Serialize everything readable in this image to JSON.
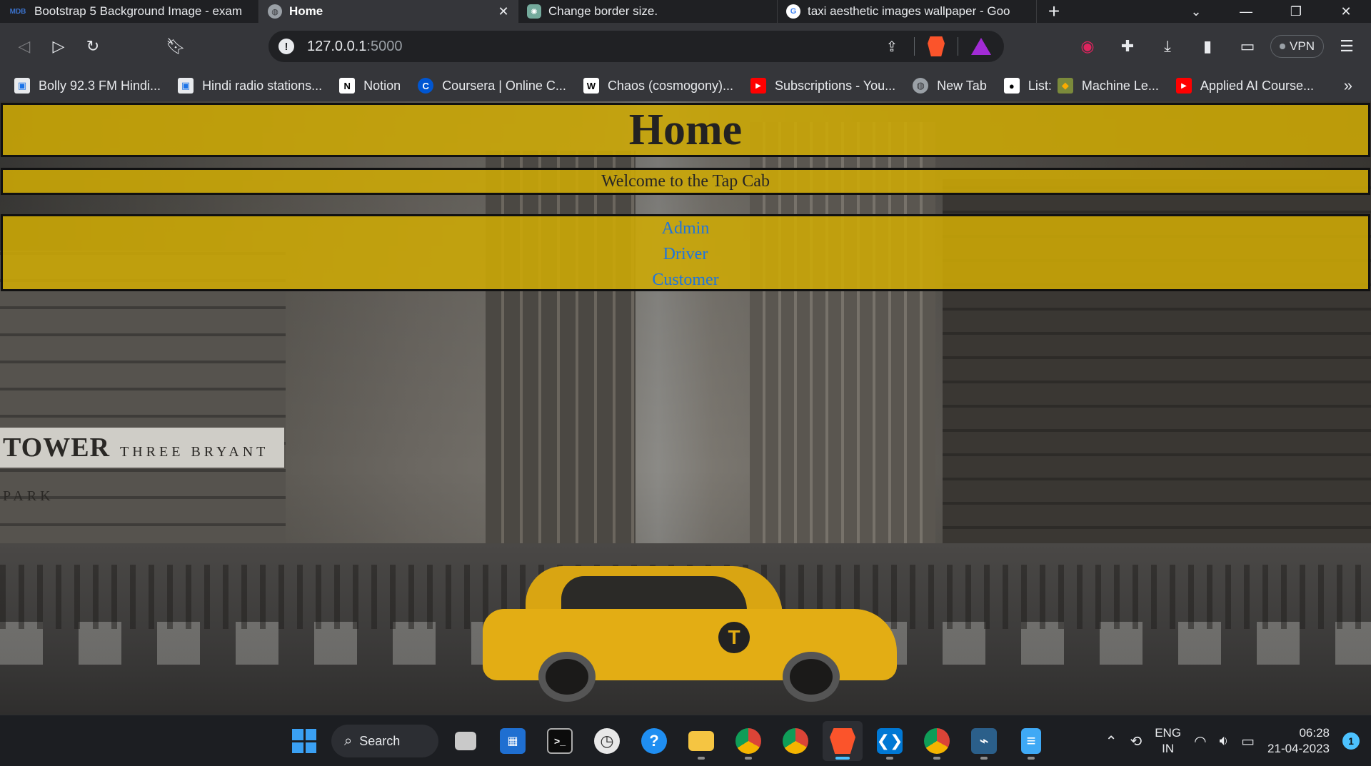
{
  "browser": {
    "tabs": [
      {
        "title": "Bootstrap 5 Background Image - exam",
        "icon": "mdb-icon",
        "active": false
      },
      {
        "title": "Home",
        "icon": "globe-icon",
        "active": true
      },
      {
        "title": "Change border size.",
        "icon": "chatgpt-icon",
        "active": false
      },
      {
        "title": "taxi aesthetic images wallpaper - Goo",
        "icon": "google-icon",
        "active": false
      }
    ],
    "new_tab_label": "+",
    "address": {
      "host": "127.0.0.1",
      "port": ":5000"
    },
    "vpn_label": "VPN",
    "bookmarks": [
      {
        "label": "Bolly 92.3 FM Hindi...",
        "icon": "radio-icon"
      },
      {
        "label": "Hindi radio stations...",
        "icon": "radio-icon"
      },
      {
        "label": "Notion",
        "icon": "notion-icon"
      },
      {
        "label": "Coursera | Online C...",
        "icon": "coursera-icon"
      },
      {
        "label": "Chaos (cosmogony)...",
        "icon": "wikipedia-icon"
      },
      {
        "label": "Subscriptions - You...",
        "icon": "youtube-icon"
      },
      {
        "label": "New Tab",
        "icon": "globe-icon"
      },
      {
        "label": "List: ",
        "icon": "medium-icon"
      },
      {
        "label": "Machine Le...",
        "icon": "colab-icon"
      },
      {
        "label": "Applied AI Course...",
        "icon": "youtube-icon"
      }
    ],
    "bookmarks_more": "»"
  },
  "page": {
    "title": "Home",
    "welcome": "Welcome to the Tap Cab",
    "nav_links": [
      "Admin",
      "Driver",
      "Customer"
    ],
    "background_sign": "TOWER",
    "background_sign_sub": "THREE BRYANT PARK",
    "colors": {
      "bar": "#ceaa05",
      "link": "#1d74e0",
      "border": "#111111"
    }
  },
  "taskbar": {
    "search_label": "Search",
    "lang": "ENG",
    "region": "IN",
    "time": "06:28",
    "date": "21-04-2023",
    "notification_count": "1"
  }
}
